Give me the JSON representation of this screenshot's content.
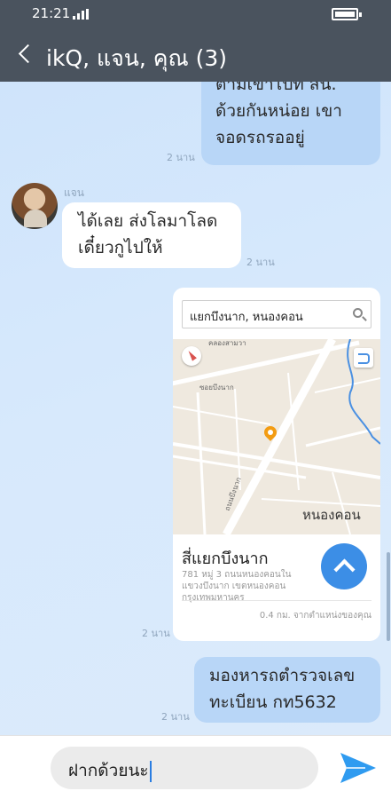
{
  "status_bar": {
    "time": "21:21"
  },
  "header": {
    "title": "ikQ, แจน, คุณ (3)"
  },
  "messages": [
    {
      "direction": "out",
      "lines": [
        "ตามเขาไปที่ สน.",
        "ด้วยกันหน่อย เขา",
        "จอดรถรออยู่"
      ],
      "time": "2 นาน"
    },
    {
      "direction": "in",
      "sender": "แจน",
      "lines": [
        "ได้เลย ส่งโลมาโลด",
        "เดี๋ยวกูไปให้"
      ],
      "time": "2 นาน"
    },
    {
      "direction": "out",
      "lines": [
        "มองหารถตำรวจเลข",
        "ทะเบียน กท5632"
      ],
      "time": "2 นาน"
    }
  ],
  "location_card": {
    "search_text": "แยกบึงนาก, หนองคอน",
    "map_labels": [
      "คลองสามวา",
      "ซอยบึงนาก",
      "ถนนบึงนาก"
    ],
    "area_name": "หนองคอน",
    "place_name": "สี่แยกบึงนาก",
    "address": "781 หมู่ 3 ถนนหนองคอนใน แขวงบึงนาก เขตหนองคอน กรุงเทพมหานคร",
    "distance": "0.4 กม. จากตำแหน่งของคุณ",
    "time": "2 นาน"
  },
  "input": {
    "value": "ฝากด้วยนะ"
  },
  "colors": {
    "header": "#4a535e",
    "bubble_out": "#b8d6f7",
    "bubble_in": "#ffffff",
    "accent": "#3c8ee6"
  }
}
